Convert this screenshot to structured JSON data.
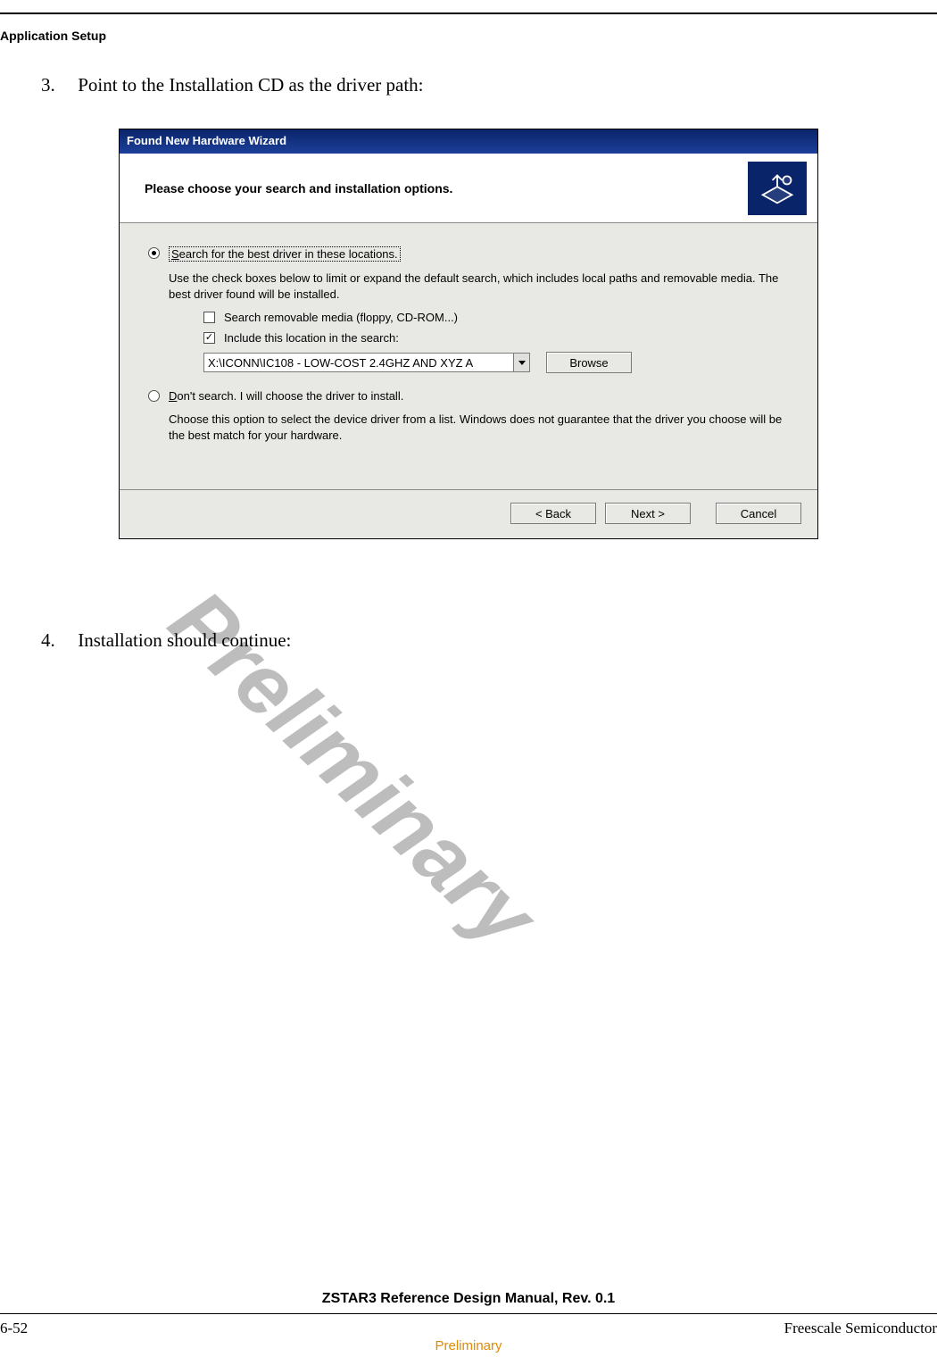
{
  "header": {
    "section": "Application Setup"
  },
  "steps": {
    "s3": {
      "num": "3.",
      "text": "Point to the Installation CD as the driver path:"
    },
    "s4": {
      "num": "4.",
      "text": "Installation should continue:"
    }
  },
  "watermark": "Preliminary",
  "wizard": {
    "title": "Found New Hardware Wizard",
    "heading": "Please choose your search and installation options.",
    "opt1": {
      "label": "Search for the best driver in these locations.",
      "desc": "Use the check boxes below to limit or expand the default search, which includes local paths and removable media. The best driver found will be installed.",
      "ck_media": "Search removable media (floppy, CD-ROM...)",
      "ck_include": "Include this location in the search:",
      "path": "X:\\ICONN\\IC108 - LOW-COST 2.4GHZ AND XYZ A",
      "browse": "Browse"
    },
    "opt2": {
      "label": "Don't search. I will choose the driver to install.",
      "desc": "Choose this option to select the device driver from a list.  Windows does not guarantee that the driver you choose will be the best match for your hardware."
    },
    "buttons": {
      "back": "< Back",
      "next": "Next >",
      "cancel": "Cancel"
    }
  },
  "footer": {
    "title": "ZSTAR3 Reference Design Manual, Rev. 0.1",
    "page": "6-52",
    "company": "Freescale Semiconductor",
    "prelim": "Preliminary"
  }
}
